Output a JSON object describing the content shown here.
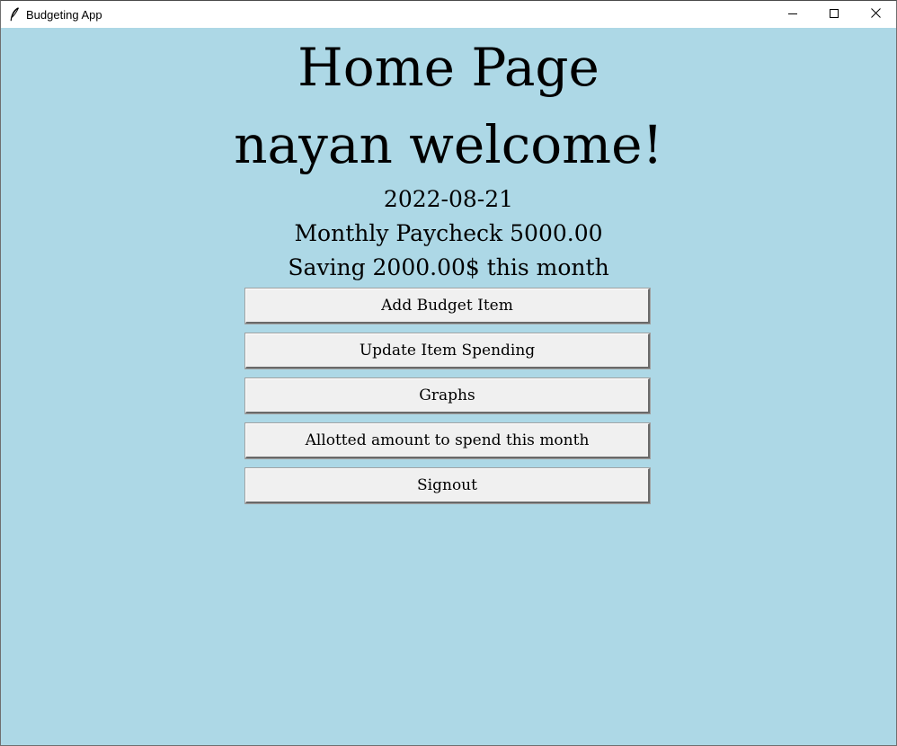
{
  "window": {
    "title": "Budgeting App",
    "app_icon": "feather-icon",
    "controls": [
      "minimize-icon",
      "maximize-icon",
      "close-icon"
    ]
  },
  "home": {
    "heading": "Home Page",
    "welcome": "nayan welcome!",
    "date": "2022-08-21",
    "paycheck": "Monthly Paycheck 5000.00",
    "saving": "Saving 2000.00$ this month"
  },
  "buttons": {
    "add_item": "Add Budget Item",
    "update_spending": "Update Item Spending",
    "graphs": "Graphs",
    "allotted": "Allotted amount to spend this month",
    "signout": "Signout"
  },
  "colors": {
    "background": "#ADD8E6",
    "button_face": "#F0F0F0",
    "titlebar": "#FFFFFF"
  }
}
